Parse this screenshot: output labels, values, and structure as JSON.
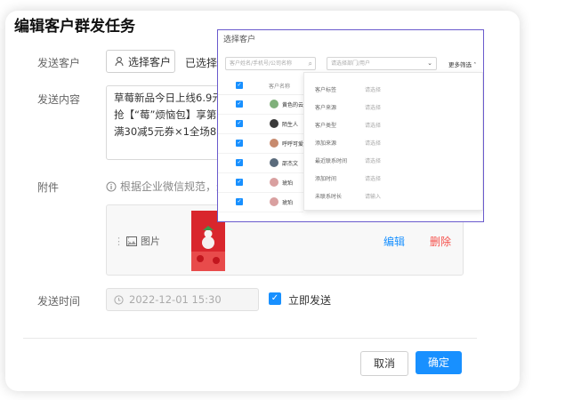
{
  "dialog": {
    "title": "编辑客户群发任务",
    "labels": {
      "send_customer": "发送客户",
      "send_content": "发送内容",
      "attachment": "附件",
      "send_time": "发送时间"
    },
    "select_customer_button": "选择客户",
    "selected_text": "已选择",
    "content_lines": [
      "草莓新品今日上线6.9元",
      "抢【“莓”烦恼包】享第",
      "满30减5元券×1全场85"
    ],
    "attachment_tip": "根据企业微信规范，最",
    "attachment_item": {
      "type_label": "图片",
      "edit": "编辑",
      "delete": "删除"
    },
    "send_time_value": "2022-12-01 15:30",
    "send_now_checked": true,
    "send_now_label": "立即发送",
    "cancel": "取消",
    "confirm": "确定",
    "accent_color": "#1890ff",
    "danger_color": "#f5514c"
  },
  "picker": {
    "title": "选择客户",
    "search_placeholder": "客户姓名/手机号/公司名称",
    "dept_placeholder": "请选择部门/用户",
    "more_filter": "更多筛选",
    "column_name": "客户名称",
    "customers": [
      {
        "name": "黄色的云",
        "avatar_color": "#7fb07a"
      },
      {
        "name": "陌生人",
        "avatar_color": "#3a3a3a"
      },
      {
        "name": "呼呼可爱",
        "avatar_color": "#c78a6e"
      },
      {
        "name": "邵杰文",
        "avatar_color": "#5a6b7c"
      },
      {
        "name": "琥珀",
        "avatar_color": "#d9a0a0"
      },
      {
        "name": "琥珀",
        "avatar_color": "#d9a0a0"
      }
    ],
    "filters": [
      {
        "label": "客户标签",
        "value": "请选择"
      },
      {
        "label": "客户来源",
        "value": "请选择"
      },
      {
        "label": "客户类型",
        "value": "请选择"
      },
      {
        "label": "添加来源",
        "value": "请选择"
      },
      {
        "label": "最近联系时间",
        "value": "请选择"
      },
      {
        "label": "添加时间",
        "value": "请选择"
      },
      {
        "label": "未联系时长",
        "value": "请输入"
      }
    ]
  }
}
